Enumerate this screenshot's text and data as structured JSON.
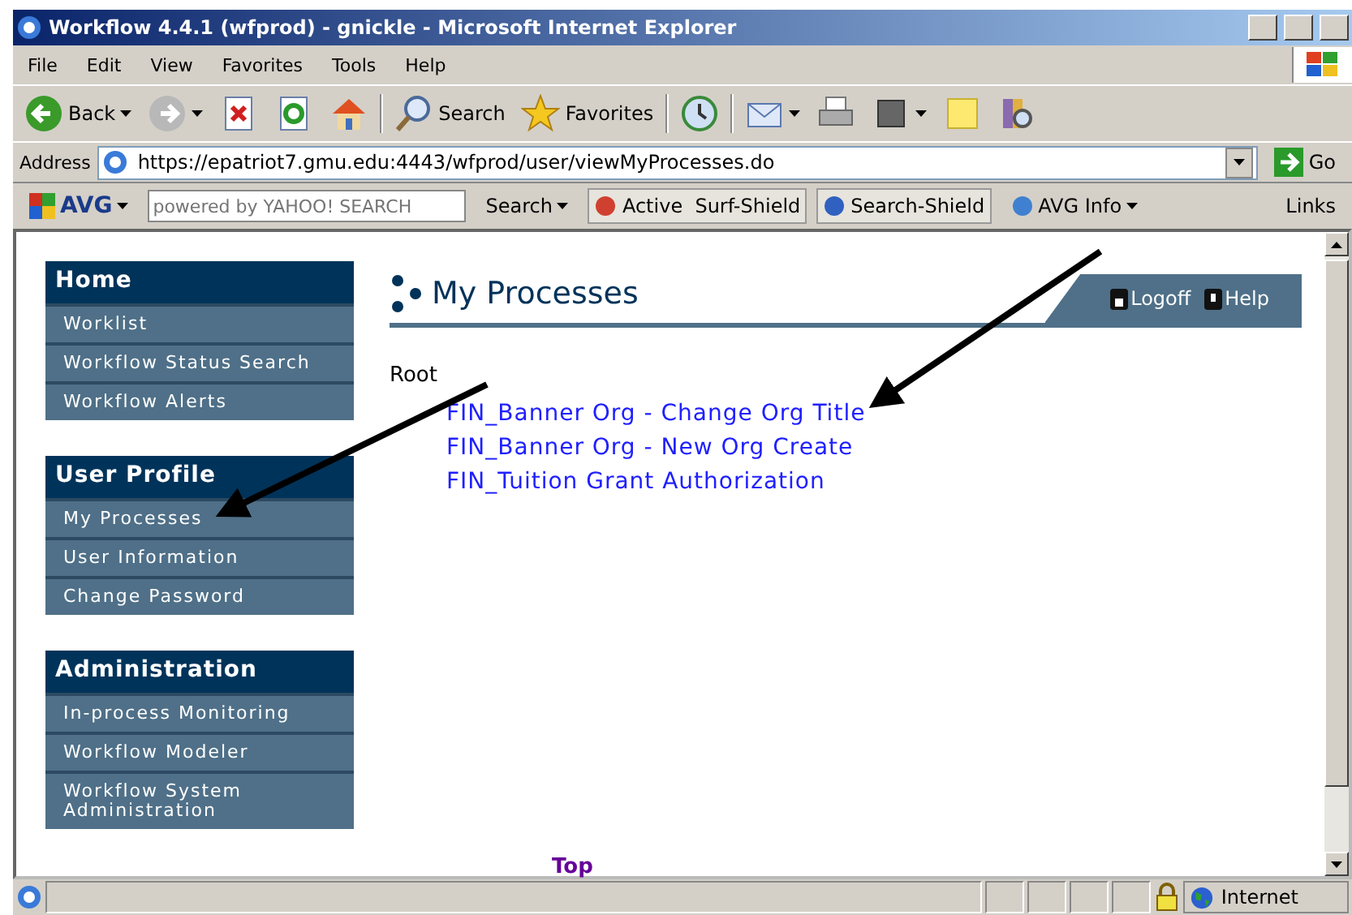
{
  "window": {
    "title": "Workflow 4.4.1 (wfprod) - gnickle - Microsoft Internet Explorer"
  },
  "menu_bar": [
    "File",
    "Edit",
    "View",
    "Favorites",
    "Tools",
    "Help"
  ],
  "toolbar": [
    {
      "kind": "back",
      "label": "Back",
      "dropdown": true
    },
    {
      "kind": "forward",
      "dropdown": true
    },
    {
      "kind": "stop"
    },
    {
      "kind": "refresh"
    },
    {
      "kind": "home"
    },
    {
      "kind": "search",
      "label": "Search"
    },
    {
      "kind": "favorites",
      "label": "Favorites"
    },
    {
      "kind": "history"
    },
    {
      "kind": "mail",
      "dropdown": true
    },
    {
      "kind": "print"
    },
    {
      "kind": "edit",
      "dropdown": true
    },
    {
      "kind": "note"
    },
    {
      "kind": "research"
    }
  ],
  "address_bar": {
    "label": "Address",
    "value": "https://epatriot7.gmu.edu:4443/wfprod/user/viewMyProcesses.do",
    "go": "Go"
  },
  "avg_bar": {
    "logo": "AVG",
    "search_placeholder": "powered by YAHOO! SEARCH",
    "search_button": "Search",
    "buttons": [
      "Active  Surf-Shield",
      "Search-Shield",
      "AVG Info"
    ],
    "links": "Links"
  },
  "sidebar": [
    {
      "title": "Home",
      "items": [
        "Worklist",
        "Workflow Status Search",
        "Workflow Alerts"
      ]
    },
    {
      "title": "User Profile",
      "items": [
        "My Processes",
        "User Information",
        "Change Password"
      ]
    },
    {
      "title": "Administration",
      "items": [
        "In-process Monitoring",
        "Workflow Modeler",
        "Workflow System Administration"
      ]
    }
  ],
  "header": {
    "title": "My Processes",
    "links": [
      {
        "kind": "lock",
        "label": "Logoff"
      },
      {
        "kind": "help",
        "label": "Help"
      }
    ]
  },
  "tree": {
    "root": "Root",
    "items": [
      "FIN_Banner Org - Change Org Title",
      "FIN_Banner Org - New Org Create",
      "FIN_Tuition Grant Authorization"
    ]
  },
  "footer_link": "Top",
  "status_bar": {
    "zone": "Internet"
  }
}
